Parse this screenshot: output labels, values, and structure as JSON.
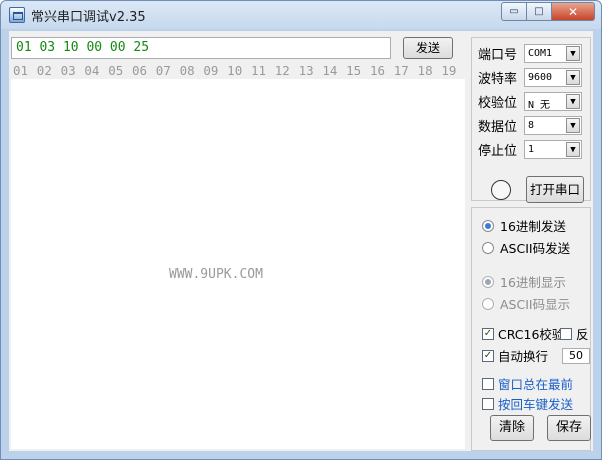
{
  "window": {
    "title": "常兴串口调试v2.35",
    "min_glyph": "▭",
    "max_glyph": "□",
    "close_glyph": "✕"
  },
  "send": {
    "value": "01 03 10 00 00 25",
    "button": "发送"
  },
  "ruler": [
    "01",
    "02",
    "03",
    "04",
    "05",
    "06",
    "07",
    "08",
    "09",
    "10",
    "11",
    "12",
    "13",
    "14",
    "15",
    "16",
    "17",
    "18",
    "19"
  ],
  "receive": {
    "watermark": "WWW.9UPK.COM"
  },
  "serial": {
    "port": {
      "label": "端口号",
      "value": "COM1"
    },
    "baud": {
      "label": "波特率",
      "value": "9600"
    },
    "parity": {
      "label": "校验位",
      "value": "N 无"
    },
    "databits": {
      "label": "数据位",
      "value": "8"
    },
    "stopbits": {
      "label": "停止位",
      "value": "1"
    },
    "open_button": "打开串口"
  },
  "options": {
    "send_hex": "16进制发送",
    "send_ascii": "ASCII码发送",
    "show_hex": "16进制显示",
    "show_ascii": "ASCII码显示",
    "crc16": "CRC16校验",
    "reverse": "反",
    "auto_wrap": "自动换行",
    "wrap_width": "50",
    "always_on_top": "窗口总在最前",
    "enter_send": "按回车键发送"
  },
  "buttons": {
    "clear": "清除",
    "save": "保存"
  },
  "colors": {
    "input_text": "#128a12",
    "link_text": "#1a5fc8",
    "radio_selected": "#3a7bd5"
  },
  "icons": {
    "dropdown": "▼",
    "check": "✓"
  }
}
